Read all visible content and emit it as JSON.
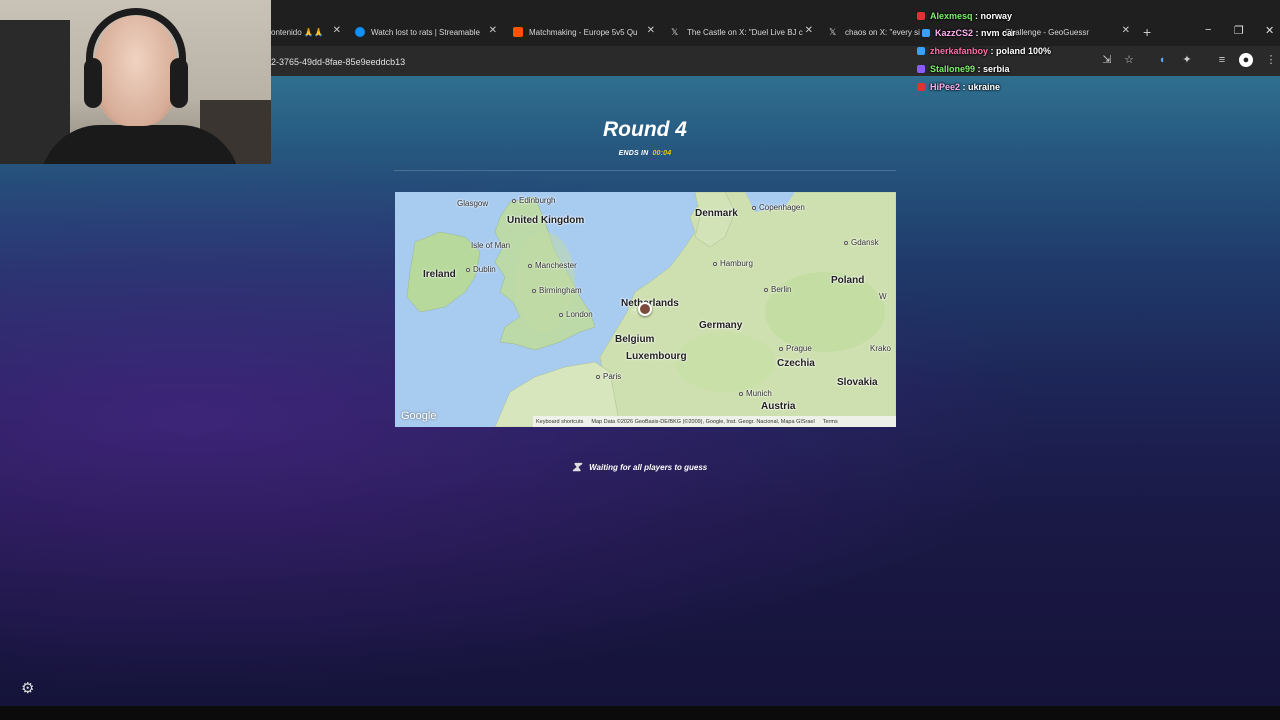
{
  "browser": {
    "tabs": [
      {
        "label": "ontenido 🙏🙏",
        "color": "#888888"
      },
      {
        "label": "Watch lost to rats | Streamable",
        "color": "#0f90fa"
      },
      {
        "label": "Matchmaking - Europe 5v5 Qu",
        "color": "#ff5500"
      },
      {
        "label": "The Castle on X: \"Duel Live BJ c",
        "color": "#dddddd"
      },
      {
        "label": "chaos on X: \"every si",
        "color": "#dddddd"
      },
      {
        "label": "Challenge - GeoGuessr",
        "color": "#f5c400"
      }
    ],
    "new_tab": "+",
    "url": "2-3765-49dd-8fae-85e9eeddcb13",
    "window_controls": [
      "−",
      "❐",
      "✕"
    ]
  },
  "game": {
    "round_title": "Round 4",
    "ends_label": "ENDS IN",
    "timer": "00:04",
    "waiting_text": "Waiting for all players to guess",
    "map": {
      "attribution_logo": "Google",
      "footer": [
        "Keyboard shortcuts",
        "Map Data ©2026 GeoBasis-DE/BKG (©2009), Google, Inst. Geogr. Nacional, Mapa GISrael",
        "Terms"
      ],
      "countries": [
        "United Kingdom",
        "Ireland",
        "Denmark",
        "Netherlands",
        "Belgium",
        "Luxembourg",
        "Germany",
        "Poland",
        "Czechia",
        "Slovakia",
        "Austria"
      ],
      "cities": [
        "Edinburgh",
        "Glasgow",
        "Isle of Man",
        "Dublin",
        "Manchester",
        "Birmingham",
        "London",
        "Paris",
        "Copenhagen",
        "Hamburg",
        "Berlin",
        "Gdansk",
        "Prague",
        "Munich",
        "Krako",
        "W"
      ]
    }
  },
  "chat": [
    {
      "user": "Alexmesq",
      "msg": "norway",
      "color": "#7cf06a",
      "badge": "#d33"
    },
    {
      "user": "KazzCS2",
      "msg": "nvm car",
      "color": "#ffb0f0",
      "badge": "#3aa0ff"
    },
    {
      "user": "zherkafanboy",
      "msg": "poland 100%",
      "color": "#ff6fa8",
      "badge": "#3aa0ff"
    },
    {
      "user": "Stallone99",
      "msg": "serbia",
      "color": "#7cf06a",
      "badge": "#8a5cff"
    },
    {
      "user": "HiPee2",
      "msg": "ukraine",
      "color": "#ffb0f0",
      "badge": "#d33"
    }
  ],
  "icons": [
    "settings-gear-icon",
    "hourglass-icon",
    "star-icon",
    "extensions-icon",
    "profile-icon",
    "menu-icon"
  ]
}
